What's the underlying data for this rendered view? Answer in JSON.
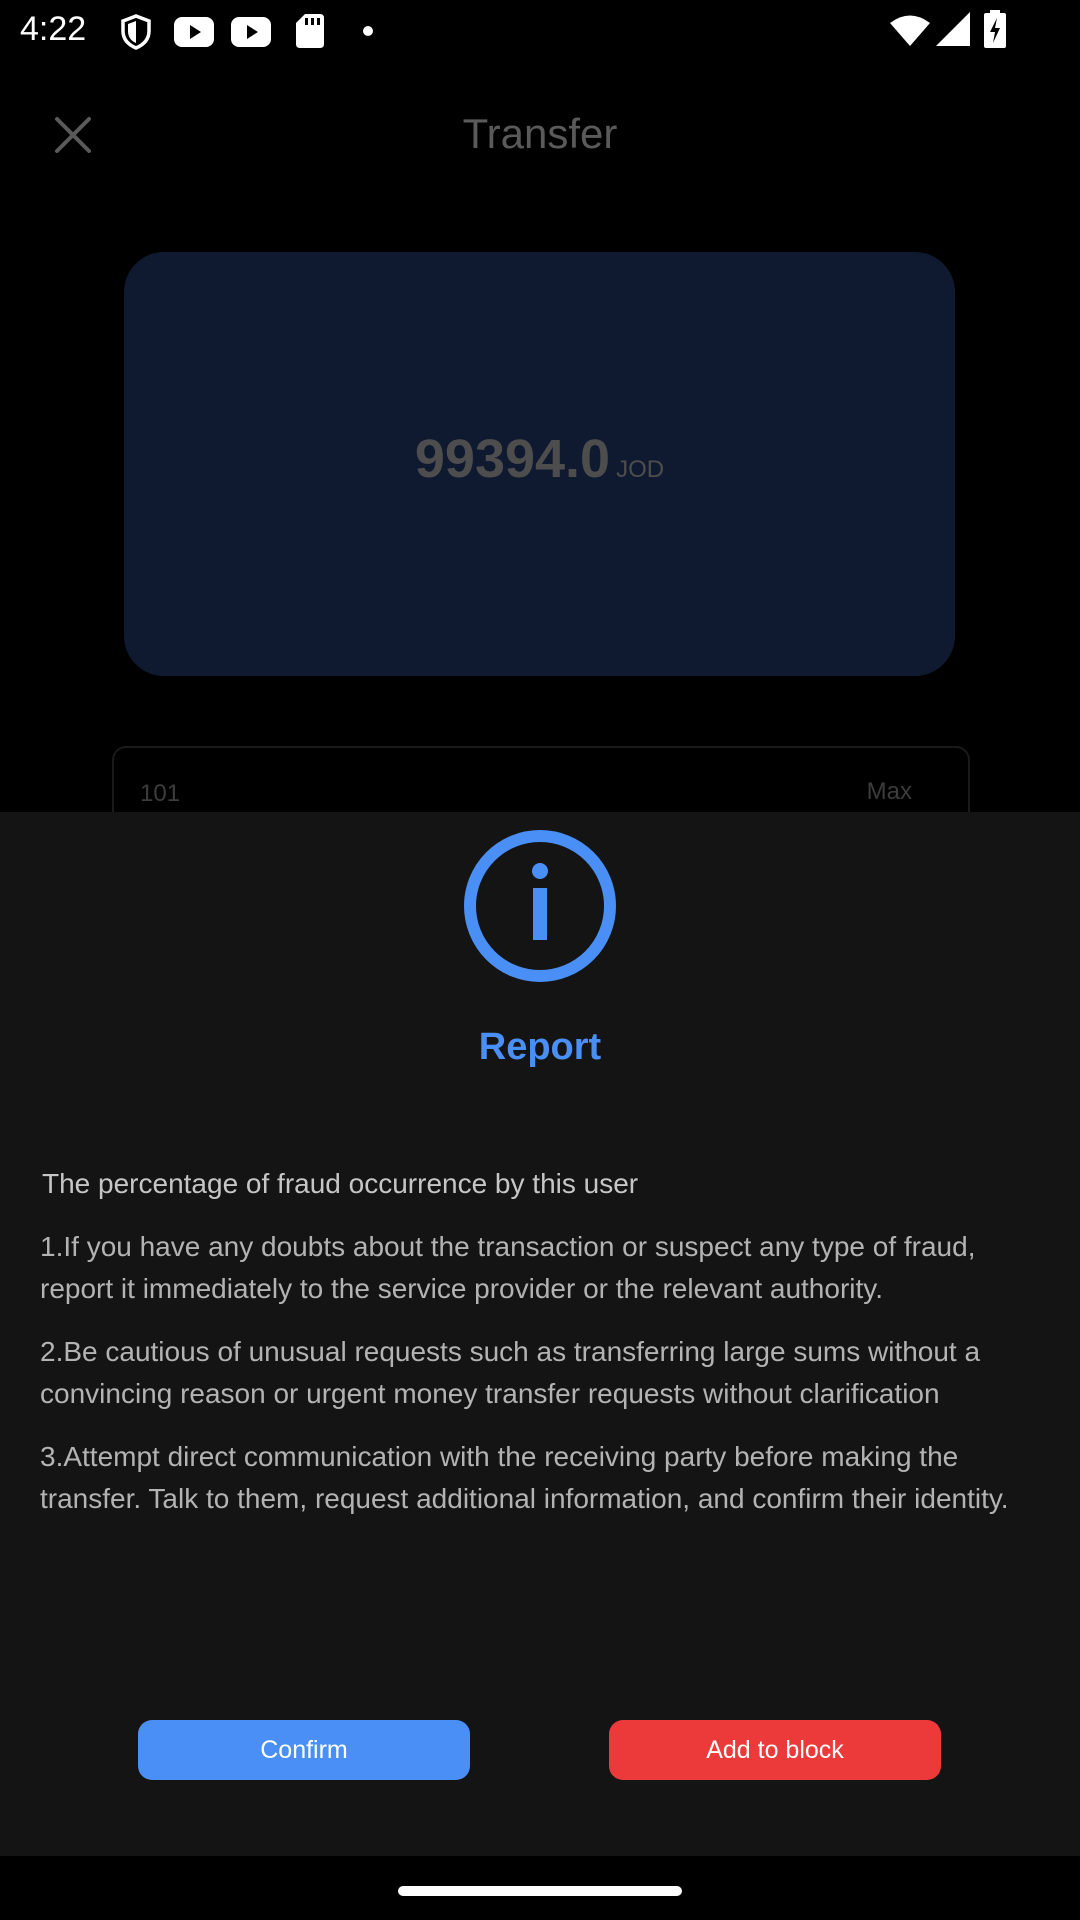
{
  "status_bar": {
    "time": "4:22",
    "icons": [
      "shield-icon",
      "youtube-icon",
      "youtube-icon",
      "sd-card-icon",
      "dot-icon",
      "wifi-icon",
      "signal-icon",
      "battery-charging-icon"
    ]
  },
  "background_page": {
    "title": "Transfer",
    "close_icon": "close-icon",
    "balance": {
      "value": "99394.0",
      "currency": "JOD"
    },
    "amount_input": {
      "value": "101",
      "max_label": "Max"
    }
  },
  "dialog": {
    "icon": "info-icon",
    "title": "Report",
    "subtitle": "The percentage of fraud occurrence by this user",
    "tips": [
      "1.If you have any doubts about the transaction or suspect any type of fraud, report it immediately to the service provider or the relevant authority.",
      "2.Be cautious of unusual requests such as transferring large sums without a convincing reason or urgent money transfer requests without clarification",
      "3.Attempt direct communication with the receiving party before making the transfer. Talk to them, request additional information, and confirm their identity."
    ],
    "confirm_label": "Confirm",
    "block_label": "Add to block"
  },
  "colors": {
    "accent": "#4a8ff5",
    "danger": "#ec3a3a",
    "sheet_bg": "#141414",
    "card_bg": "#0f1a30"
  }
}
